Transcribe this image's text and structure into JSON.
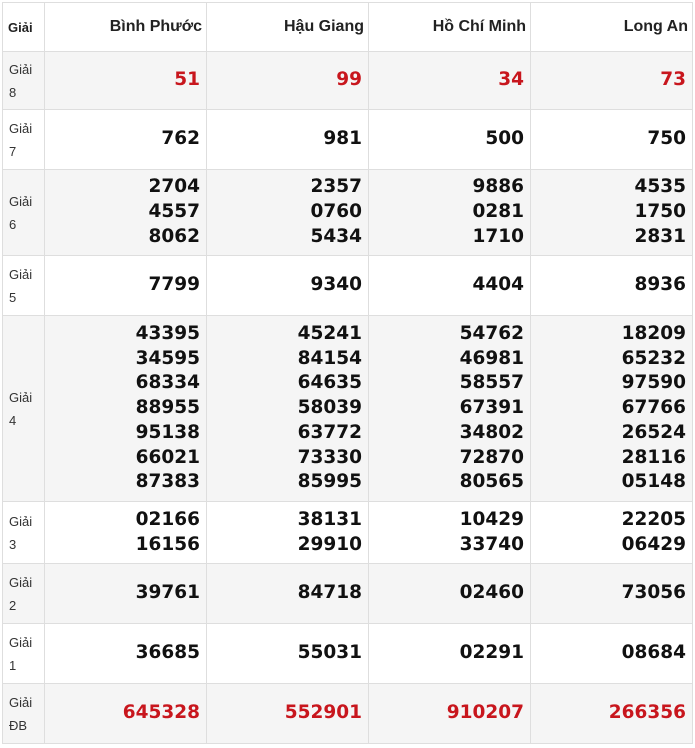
{
  "header": {
    "label": "Giải",
    "provinces": [
      "Bình Phước",
      "Hậu Giang",
      "Hồ Chí Minh",
      "Long An"
    ]
  },
  "rows": [
    {
      "label1": "Giải",
      "label2": "8",
      "values": [
        [
          "51"
        ],
        [
          "99"
        ],
        [
          "34"
        ],
        [
          "73"
        ]
      ]
    },
    {
      "label1": "Giải",
      "label2": "7",
      "values": [
        [
          "762"
        ],
        [
          "981"
        ],
        [
          "500"
        ],
        [
          "750"
        ]
      ]
    },
    {
      "label1": "Giải",
      "label2": "6",
      "values": [
        [
          "2704",
          "4557",
          "8062"
        ],
        [
          "2357",
          "0760",
          "5434"
        ],
        [
          "9886",
          "0281",
          "1710"
        ],
        [
          "4535",
          "1750",
          "2831"
        ]
      ]
    },
    {
      "label1": "Giải",
      "label2": "5",
      "values": [
        [
          "7799"
        ],
        [
          "9340"
        ],
        [
          "4404"
        ],
        [
          "8936"
        ]
      ]
    },
    {
      "label1": "Giải",
      "label2": "4",
      "values": [
        [
          "43395",
          "34595",
          "68334",
          "88955",
          "95138",
          "66021",
          "87383"
        ],
        [
          "45241",
          "84154",
          "64635",
          "58039",
          "63772",
          "73330",
          "85995"
        ],
        [
          "54762",
          "46981",
          "58557",
          "67391",
          "34802",
          "72870",
          "80565"
        ],
        [
          "18209",
          "65232",
          "97590",
          "67766",
          "26524",
          "28116",
          "05148"
        ]
      ]
    },
    {
      "label1": "Giải",
      "label2": "3",
      "values": [
        [
          "02166",
          "16156"
        ],
        [
          "38131",
          "29910"
        ],
        [
          "10429",
          "33740"
        ],
        [
          "22205",
          "06429"
        ]
      ]
    },
    {
      "label1": "Giải",
      "label2": "2",
      "values": [
        [
          "39761"
        ],
        [
          "84718"
        ],
        [
          "02460"
        ],
        [
          "73056"
        ]
      ]
    },
    {
      "label1": "Giải",
      "label2": "1",
      "values": [
        [
          "36685"
        ],
        [
          "55031"
        ],
        [
          "02291"
        ],
        [
          "08684"
        ]
      ]
    },
    {
      "label1": "Giải",
      "label2": "ĐB",
      "values": [
        [
          "645328"
        ],
        [
          "552901"
        ],
        [
          "910207"
        ],
        [
          "266356"
        ]
      ]
    }
  ],
  "colors": {
    "highlight": "#c8161d",
    "text": "#111111",
    "border": "#dedede",
    "row_shade": "#f5f5f5"
  }
}
